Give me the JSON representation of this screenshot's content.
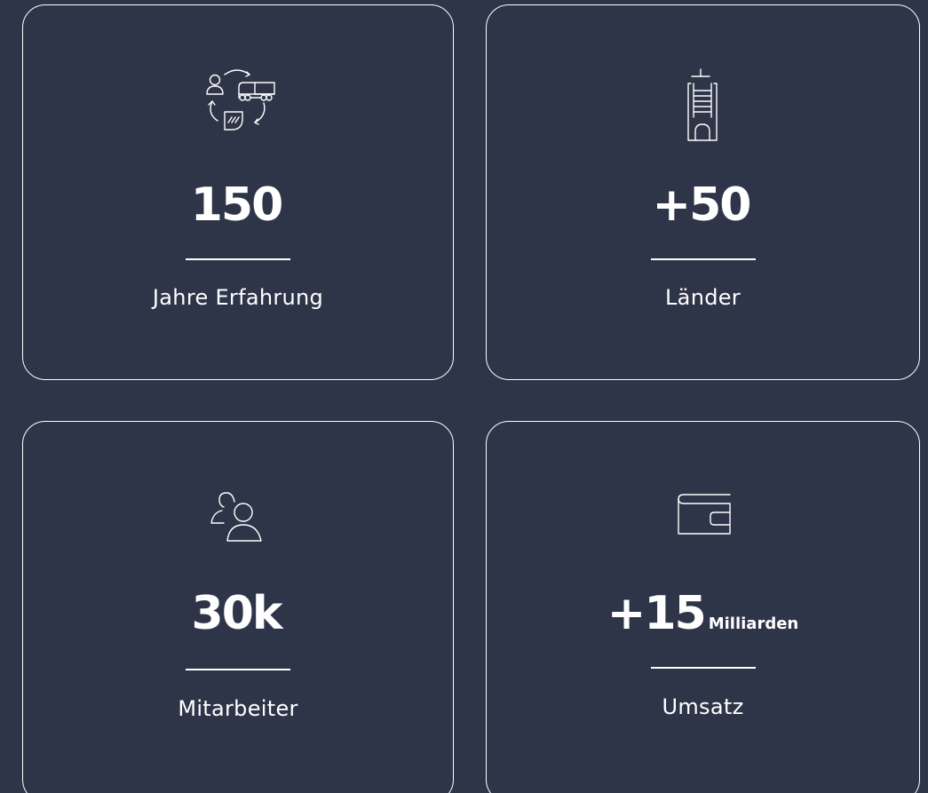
{
  "stats": [
    {
      "value": "150",
      "unit": "",
      "label": "Jahre Erfahrung",
      "icon": "logistics-cycle-icon"
    },
    {
      "value": "+50",
      "unit": "",
      "label": "Länder",
      "icon": "building-icon"
    },
    {
      "value": "30k",
      "unit": "",
      "label": "Mitarbeiter",
      "icon": "people-icon"
    },
    {
      "value": "+15",
      "unit": "Milliarden",
      "label": "Umsatz",
      "icon": "wallet-icon"
    }
  ],
  "colors": {
    "background": "#2e3549",
    "foreground": "#ffffff"
  }
}
